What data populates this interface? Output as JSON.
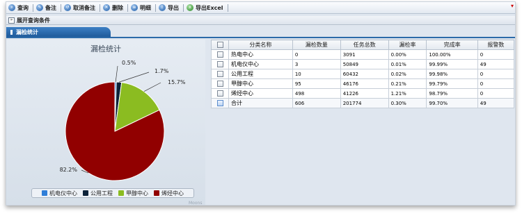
{
  "toolbar": {
    "buttons": [
      {
        "label": "查询",
        "icon": "search-icon"
      },
      {
        "label": "备注",
        "icon": "note-icon"
      },
      {
        "label": "取消备注",
        "icon": "cancel-note-icon"
      },
      {
        "label": "删除",
        "icon": "delete-icon"
      },
      {
        "label": "明细",
        "icon": "detail-icon"
      },
      {
        "label": "导出",
        "icon": "export-icon"
      },
      {
        "label": "导出Excel",
        "icon": "excel-icon"
      }
    ]
  },
  "query_bar": {
    "label": "展开查询条件"
  },
  "section": {
    "title": "漏检统计"
  },
  "chart_data": {
    "type": "pie",
    "title": "漏检统计",
    "slices": [
      {
        "label": "机电仪中心",
        "percent_text": "0.5%",
        "value": 0.5,
        "color": "#2f7ed8"
      },
      {
        "label": "公用工程",
        "percent_text": "1.7%",
        "value": 1.7,
        "color": "#0d233a"
      },
      {
        "label": "甲醇中心",
        "percent_text": "15.7%",
        "value": 15.7,
        "color": "#8bbc21"
      },
      {
        "label": "烯烃中心",
        "percent_text": "82.2%",
        "value": 82.2,
        "color": "#910000"
      }
    ],
    "legend_placement": "bottom",
    "watermark": "Moons"
  },
  "table": {
    "headers": [
      "分类名称",
      "漏检数量",
      "任务总数",
      "漏检率",
      "完成率",
      "报警数"
    ],
    "rows": [
      [
        "热电中心",
        "0",
        "3091",
        "0.00%",
        "100.00%",
        "0"
      ],
      [
        "机电仪中心",
        "3",
        "50849",
        "0.01%",
        "99.99%",
        "49"
      ],
      [
        "公用工程",
        "10",
        "60432",
        "0.02%",
        "99.98%",
        "0"
      ],
      [
        "甲醇中心",
        "95",
        "46176",
        "0.21%",
        "99.79%",
        "0"
      ],
      [
        "烯烃中心",
        "498",
        "41226",
        "1.21%",
        "98.79%",
        "0"
      ]
    ],
    "total": [
      "合计",
      "606",
      "201774",
      "0.30%",
      "99.70%",
      "49"
    ]
  },
  "colors": {
    "accent": "#2b6aa8",
    "panel": "#dfe6ef"
  }
}
